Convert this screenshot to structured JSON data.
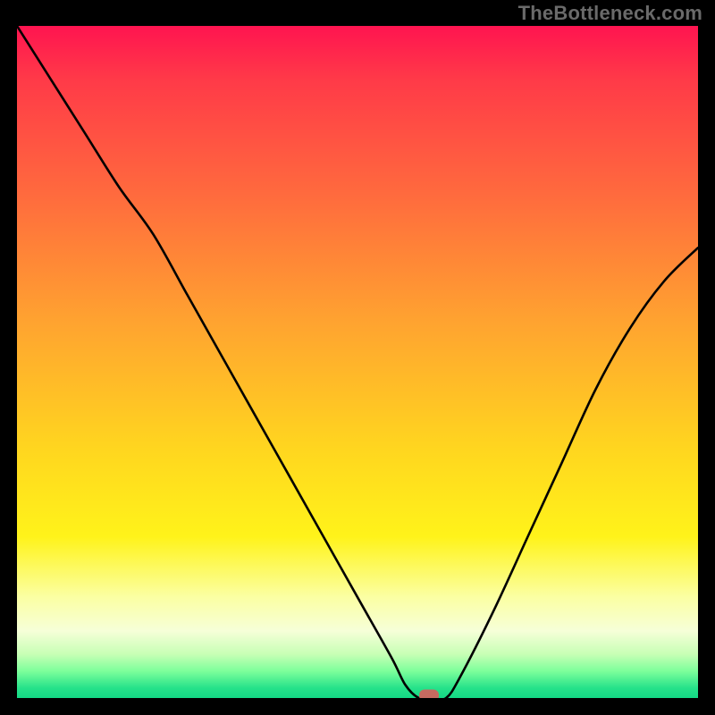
{
  "watermark": "TheBottleneck.com",
  "colors": {
    "background": "#000000",
    "curve": "#000000",
    "marker": "#c66a60",
    "gradient_stops": [
      "#ff1450",
      "#ff3a48",
      "#ff6d3d",
      "#ffa330",
      "#ffd61f",
      "#fff31a",
      "#fbffa3",
      "#f6ffd8",
      "#c7ffb5",
      "#7dff9b",
      "#26e28a",
      "#14d985"
    ]
  },
  "chart_data": {
    "type": "line",
    "title": "",
    "xlabel": "",
    "ylabel": "",
    "xlim": [
      0,
      100
    ],
    "ylim": [
      0,
      100
    ],
    "x": [
      0,
      5,
      10,
      15,
      20,
      25,
      30,
      35,
      40,
      45,
      50,
      55,
      57,
      59,
      61,
      63,
      65,
      70,
      75,
      80,
      85,
      90,
      95,
      100
    ],
    "values": [
      100,
      92,
      84,
      76,
      69,
      60,
      51,
      42,
      33,
      24,
      15,
      6,
      2,
      0,
      0,
      0,
      3,
      13,
      24,
      35,
      46,
      55,
      62,
      67
    ],
    "marker": {
      "x": 60.5,
      "y": 0
    },
    "note": "y is distance above the bottom edge of the colored plot area, 0–100 scale read from pixel geometry; curve is a V reaching the baseline near x≈60 with a short flat segment."
  }
}
